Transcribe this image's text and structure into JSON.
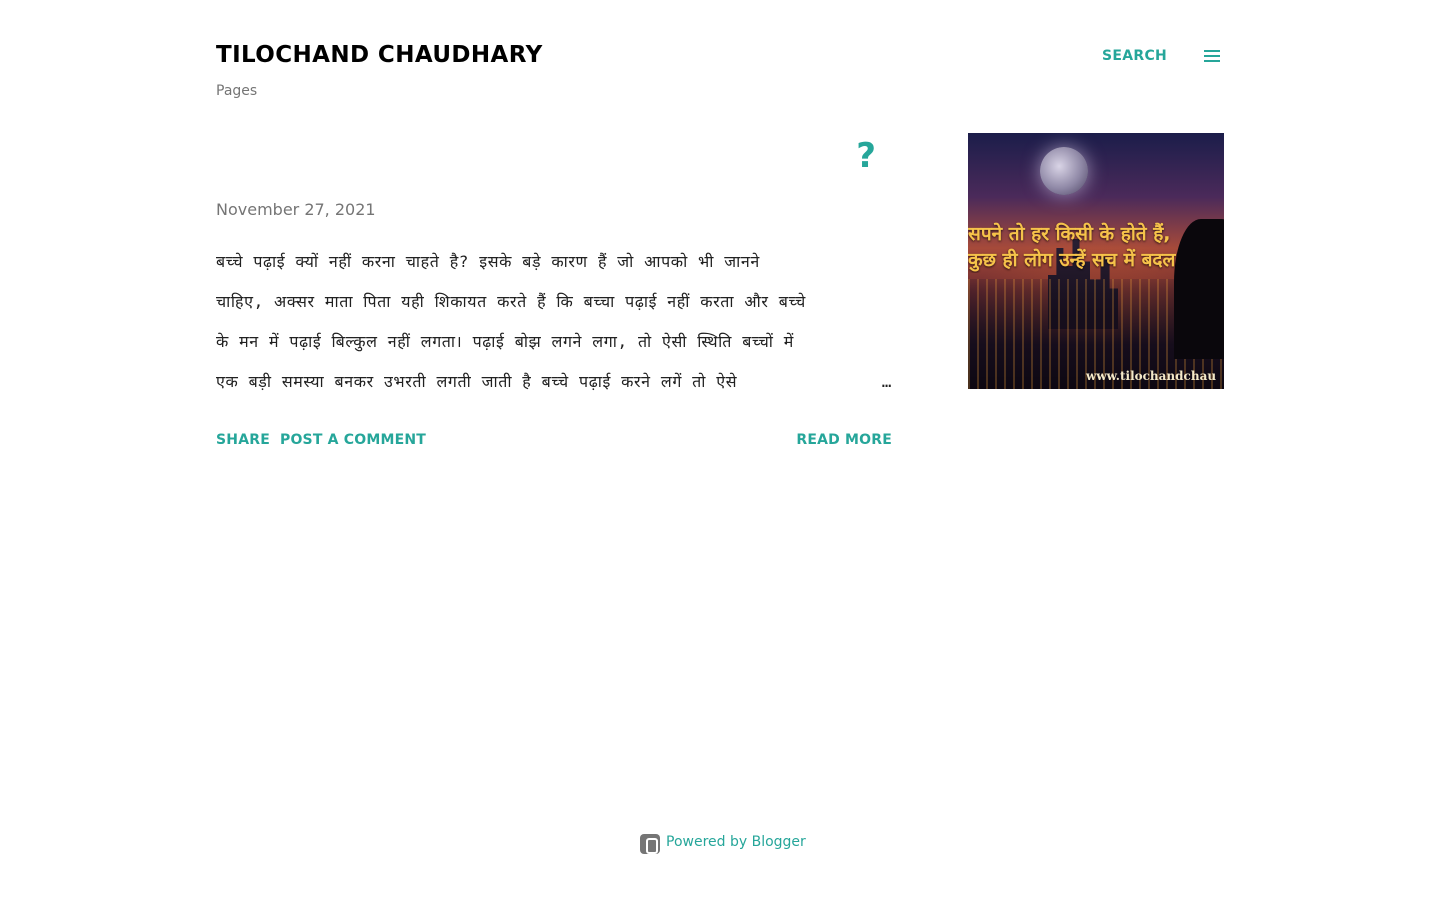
{
  "header": {
    "blog_title": "TILOCHAND CHAUDHARY",
    "search_label": "SEARCH",
    "pages_label": "Pages",
    "menu_icon": "hamburger-menu-icon"
  },
  "post": {
    "title": "?",
    "date": "November 27, 2021",
    "snippet_lines": [
      "बच्चे पढ़ाई क्यों नहीं करना चाहते है?  इसके बड़े कारण हैं जो आपको भी जानने",
      "चाहिए, अक्सर माता पिता यही शिकायत करते हैं कि बच्चा पढ़ाई नहीं करता और बच्चे",
      "के मन में पढ़ाई बिल्कुल नहीं लगता। पढ़ाई बोझ लगने लगा, तो ऐसी स्थिति बच्चों में",
      "एक बड़ी समस्या बनकर उभरती लगती जाती है बच्चे पढ़ाई करने लगें तो ऐसे"
    ],
    "ellipsis": "…",
    "share_label": "SHARE",
    "comment_label": "POST A COMMENT",
    "read_more_label": "READ MORE"
  },
  "thumbnail": {
    "caption_lines": [
      "सपने तो हर किसी के होते हैं,",
      "कुछ ही लोग उन्हें सच में बदल"
    ],
    "url_text": "www.tilochandchau"
  },
  "footer": {
    "powered_by": "Powered by Blogger",
    "icon": "blogger-icon"
  },
  "colors": {
    "accent": "#26a69a",
    "muted": "#757575",
    "title": "#000000"
  }
}
